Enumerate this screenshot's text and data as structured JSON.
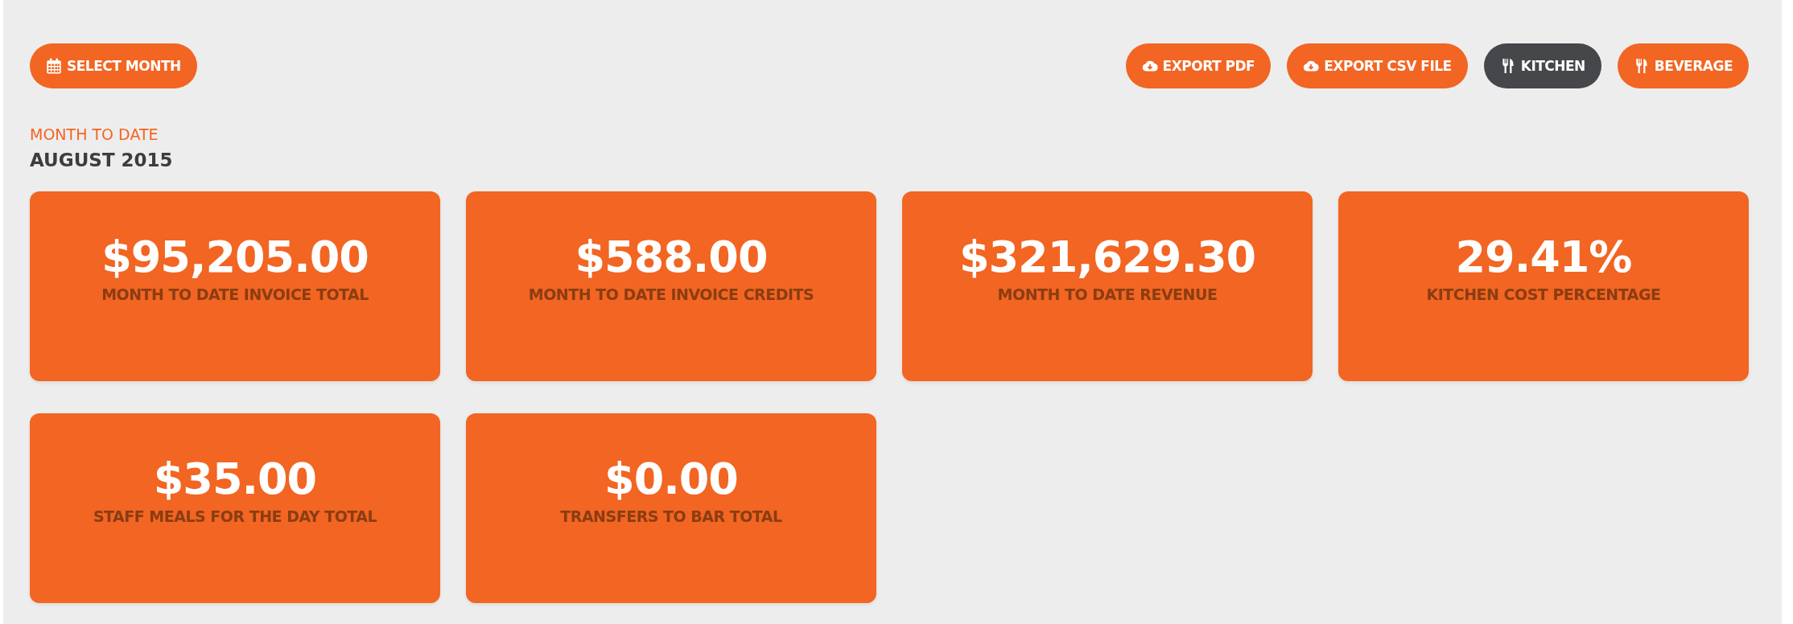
{
  "select_month_button": {
    "label": "SELECT MONTH"
  },
  "actions": [
    {
      "label": "EXPORT PDF",
      "kind": "export"
    },
    {
      "label": "EXPORT CSV FILE",
      "kind": "export"
    },
    {
      "label": "KITCHEN",
      "kind": "toggle",
      "selected": true
    },
    {
      "label": "BEVERAGE",
      "kind": "toggle",
      "selected": false
    }
  ],
  "period": {
    "caption": "MONTH TO DATE",
    "title": "AUGUST 2015"
  },
  "cards": [
    {
      "value": "$95,205.00",
      "label": "MONTH TO DATE INVOICE TOTAL"
    },
    {
      "value": "$588.00",
      "label": "MONTH TO DATE INVOICE CREDITS"
    },
    {
      "value": "$321,629.30",
      "label": "MONTH TO DATE REVENUE"
    },
    {
      "value": "29.41%",
      "label": "KITCHEN COST PERCENTAGE"
    },
    {
      "value": "$35.00",
      "label": "STAFF MEALS FOR THE DAY TOTAL"
    },
    {
      "value": "$0.00",
      "label": "TRANSFERS TO BAR TOTAL"
    }
  ]
}
